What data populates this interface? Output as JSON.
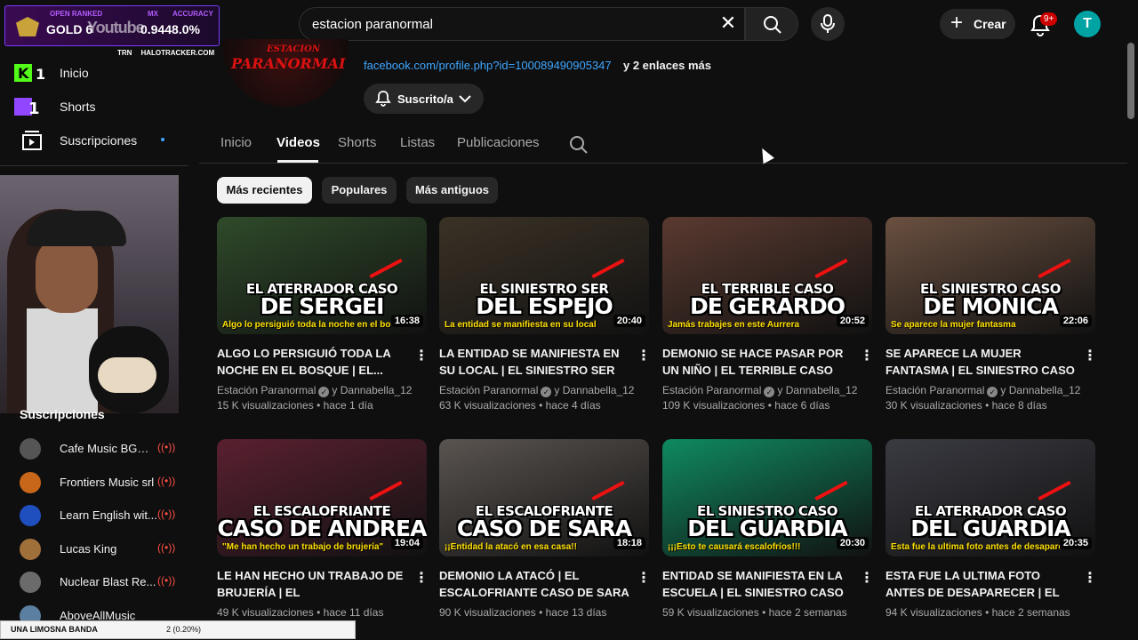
{
  "overlay": {
    "rank": "GOLD 6",
    "watermark": "Youtube",
    "label_openranked": "OPEN RANKED",
    "label_mx": "MX",
    "label_accuracy": "ACCURACY",
    "stats": "0.94",
    "accuracy": "48.0%",
    "trn": "TRN",
    "tracker": "HALOTRACKER.COM"
  },
  "header": {
    "search_query": "estacion paranormal",
    "create_label": "Crear",
    "notif_count": "9+",
    "avatar_letter": "T"
  },
  "sidebar": {
    "items": [
      {
        "label": "Inicio"
      },
      {
        "label": "Shorts"
      },
      {
        "label": "Suscripciones"
      }
    ],
    "subs_title": "Suscripciones",
    "subscriptions": [
      {
        "name": "Cafe Music BGM ...",
        "color": "#555555"
      },
      {
        "name": "Frontiers Music srl",
        "color": "#c8661a"
      },
      {
        "name": "Learn English wit...",
        "color": "#1f4fbf"
      },
      {
        "name": "Lucas King",
        "color": "#a0703a"
      },
      {
        "name": "Nuclear Blast Re...",
        "color": "#6b6b6b"
      },
      {
        "name": "AboveAllMusic",
        "color": "#5a7fa0"
      }
    ]
  },
  "channel": {
    "logo_top": "ESTACION",
    "logo_main": "PARANORMAL",
    "link": "facebook.com/profile.php?id=100089490905347",
    "more_links": "y 2 enlaces más",
    "subscribed_label": "Suscrito/a"
  },
  "tabs": [
    "Inicio",
    "Videos",
    "Shorts",
    "Listas",
    "Publicaciones"
  ],
  "chips": [
    "Más recientes",
    "Populares",
    "Más antiguos"
  ],
  "videos": [
    {
      "thumb_l1": "EL ATERRADOR CASO",
      "thumb_l2": "DE SERGEI",
      "thumb_l3": "Algo lo persiguió toda la noche en el bosque",
      "duration": "16:38",
      "title": "ALGO LO PERSIGUIÓ TODA LA NOCHE EN EL BOSQUE | EL...",
      "channel": "Estación Paranormal",
      "collab": "y Dannabella_12",
      "views": "15 K visualizaciones",
      "age": "hace 1 día",
      "bg": "#2f4a2a"
    },
    {
      "thumb_l1": "EL SINIESTRO SER",
      "thumb_l2": "DEL ESPEJO",
      "thumb_l3": "La entidad se manifiesta en su local",
      "duration": "20:40",
      "title": "LA ENTIDAD SE MANIFIESTA EN SU LOCAL | EL SINIESTRO SER DEL...",
      "channel": "Estación Paranormal",
      "collab": "y Dannabella_12",
      "views": "63 K visualizaciones",
      "age": "hace 4 días",
      "bg": "#3b3226"
    },
    {
      "thumb_l1": "EL TERRIBLE CASO",
      "thumb_l2": "DE GERARDO",
      "thumb_l3": "Jamás trabajes en este Aurrera",
      "duration": "20:52",
      "title": "DEMONIO SE HACE PASAR POR UN NIÑO | EL TERRIBLE CASO DE...",
      "channel": "Estación Paranormal",
      "collab": "y Dannabella_12",
      "views": "109 K visualizaciones",
      "age": "hace 6 días",
      "bg": "#5a3a30"
    },
    {
      "thumb_l1": "EL SINIESTRO CASO",
      "thumb_l2": "DE MONICA",
      "thumb_l3": "Se aparece la mujer fantasma",
      "duration": "22:06",
      "title": "SE APARECE LA MUJER FANTASMA | EL SINIESTRO CASO DE MONICA",
      "channel": "Estación Paranormal",
      "collab": "y Dannabella_12",
      "views": "30 K visualizaciones",
      "age": "hace 8 días",
      "bg": "#6a5040"
    },
    {
      "thumb_l1": "EL ESCALOFRIANTE",
      "thumb_l2": "CASO DE ANDREA",
      "thumb_l3": "\"Me han hecho un trabajo de brujería\"",
      "duration": "19:04",
      "title": "LE HAN HECHO UN TRABAJO DE BRUJERÍA | EL ESCALOFRIANTE...",
      "channel": "",
      "collab": "",
      "views": "49 K visualizaciones",
      "age": "hace 11 días",
      "bg": "#5a2030"
    },
    {
      "thumb_l1": "EL ESCALOFRIANTE",
      "thumb_l2": "CASO DE SARA",
      "thumb_l3": "¡¡Entidad la atacó en esa casa!!",
      "duration": "18:18",
      "title": "DEMONIO LA ATACÓ | EL ESCALOFRIANTE CASO DE SARA",
      "channel": "",
      "collab": "",
      "views": "90 K visualizaciones",
      "age": "hace 13 días",
      "bg": "#5a5450"
    },
    {
      "thumb_l1": "EL SINIESTRO CASO",
      "thumb_l2": "DEL GUARDIA",
      "thumb_l3": "¡¡¡Esto te causará escalofríos!!!",
      "duration": "20:30",
      "title": "ENTIDAD SE MANIFIESTA EN LA ESCUELA | EL SINIESTRO CASO DE...",
      "channel": "",
      "collab": "",
      "views": "59 K visualizaciones",
      "age": "hace 2 semanas",
      "bg": "#0f8a60"
    },
    {
      "thumb_l1": "EL ATERRADOR CASO",
      "thumb_l2": "DEL GUARDIA",
      "thumb_l3": "Esta fue la ultima foto antes de desaparecer",
      "duration": "20:35",
      "title": "ESTA FUE LA ULTIMA FOTO ANTES DE DESAPARECER | EL ATERRADO...",
      "channel": "",
      "collab": "",
      "views": "94 K visualizaciones",
      "age": "hace 2 semanas",
      "bg": "#3a3a42"
    }
  ],
  "donation_bar": {
    "name": "UNA LIMOSNA BANDA",
    "value": "2 (0.20%)"
  }
}
